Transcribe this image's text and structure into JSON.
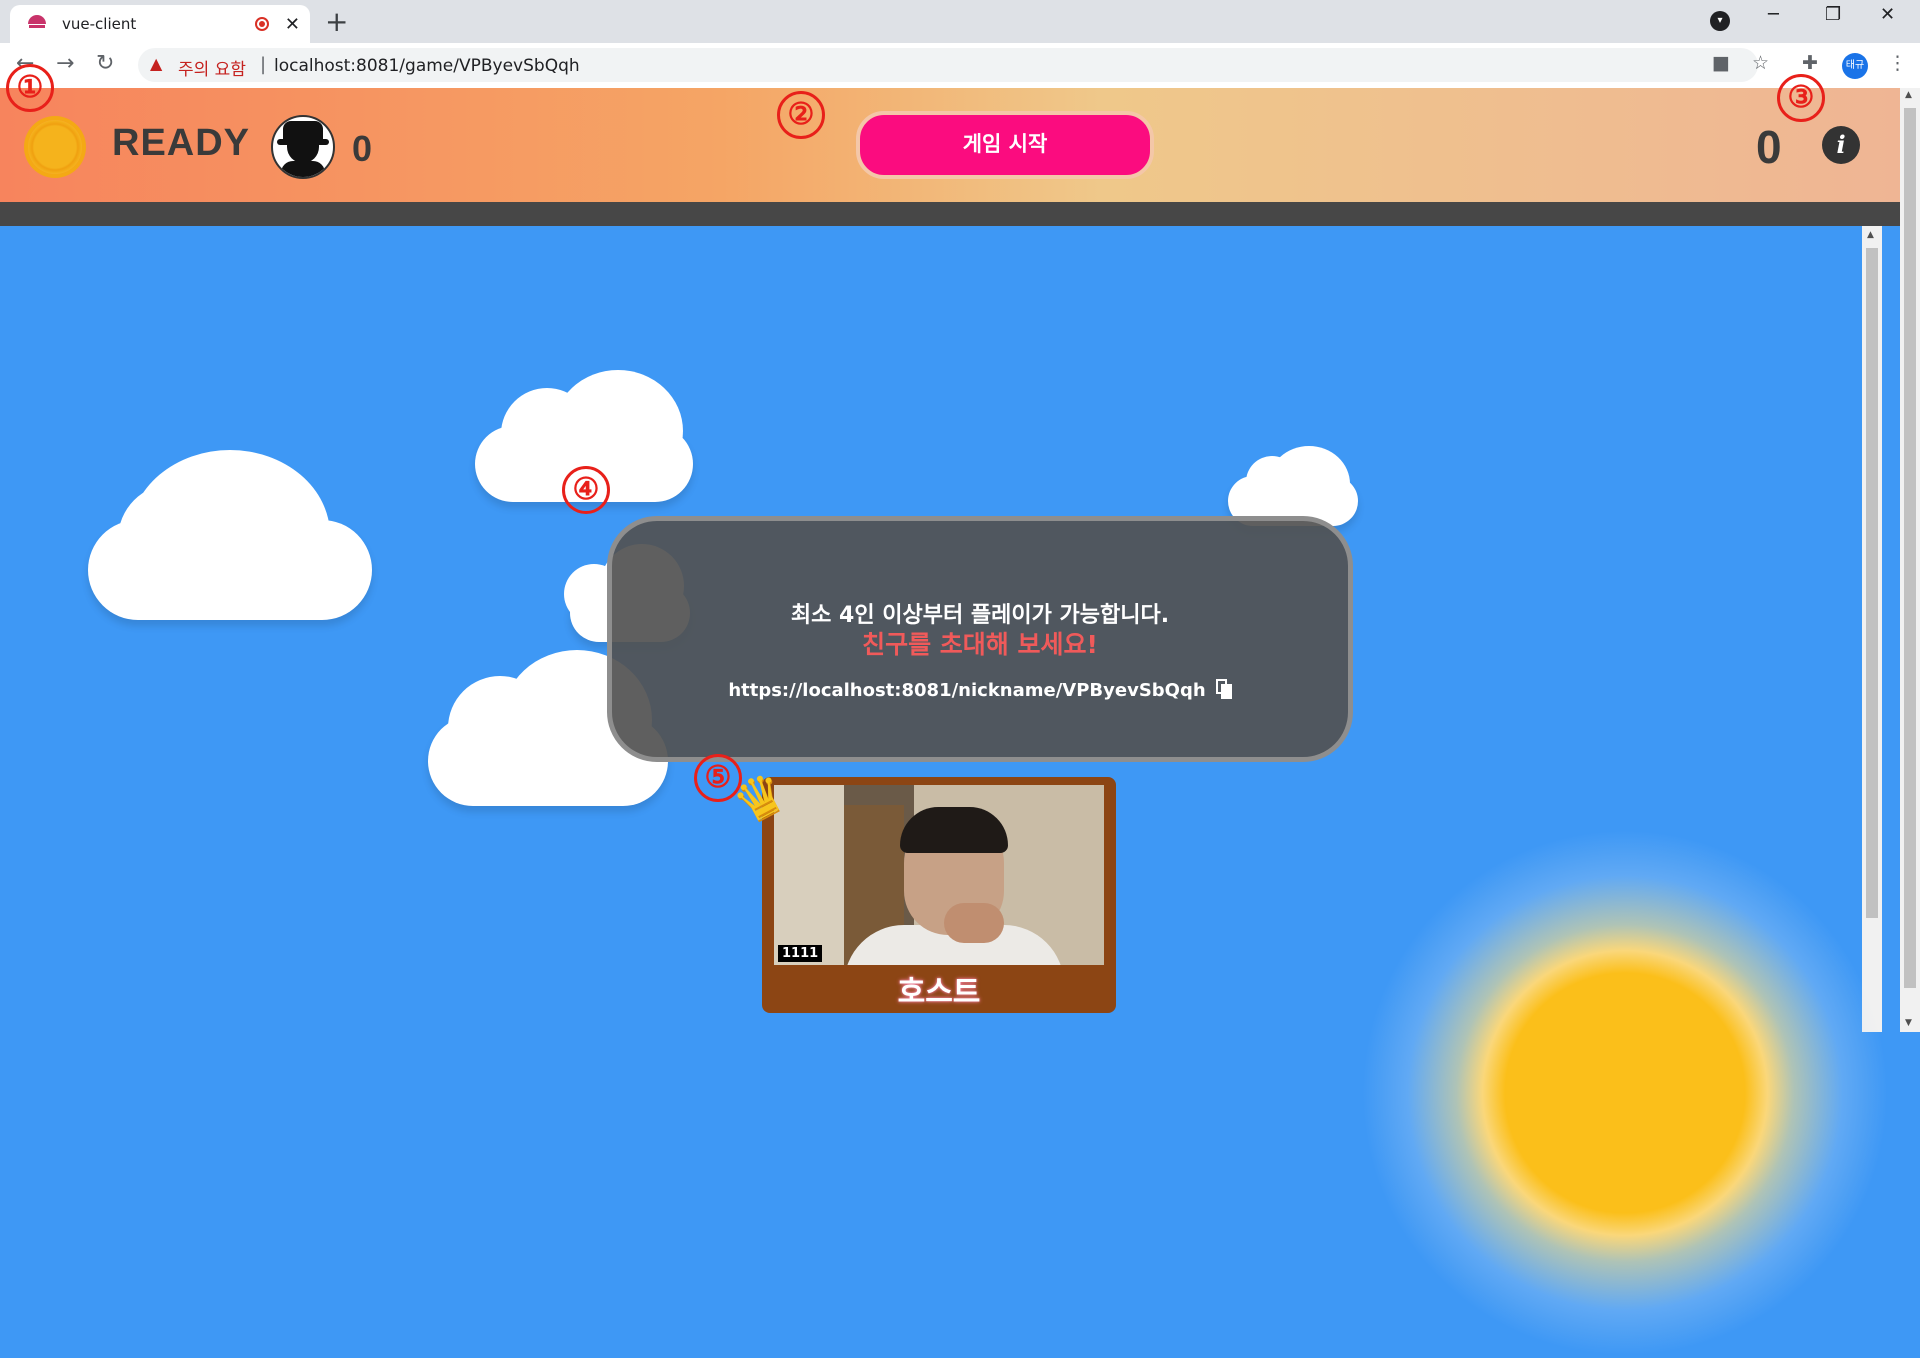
{
  "browser": {
    "tab_title": "vue-client",
    "tab_close": "✕",
    "new_tab": "+",
    "security_warning": "주의 요함",
    "separator": "|",
    "url": "localhost:8081/game/VPByevSbQqh",
    "profile_initials": "태규"
  },
  "header": {
    "phase": "READY",
    "spy_count": "0",
    "start_button_label": "게임 시작",
    "round_count": "0",
    "info_glyph": "i"
  },
  "modal": {
    "line1": "최소 4인 이상부터 플레이가 가능합니다.",
    "line2": "친구를 초대해 보세요!",
    "invite_link": "https://localhost:8081/nickname/VPByevSbQqh"
  },
  "player": {
    "video_id": "1111",
    "name": "호스트"
  },
  "annotations": [
    "①",
    "②",
    "③",
    "④",
    "⑤"
  ],
  "colors": {
    "sky": "#3e98f5",
    "start_button": "#fb0c7f",
    "modal_bg": "#515151",
    "invite_highlight": "#f05a5a",
    "player_card": "#8c4514",
    "annotation": "#e8201a"
  },
  "icons": [
    "sun-icon",
    "spy-icon",
    "info-icon",
    "copy-icon",
    "crown-icon",
    "back-icon",
    "forward-icon",
    "reload-icon",
    "warning-icon",
    "camera-icon",
    "star-icon",
    "extensions-icon",
    "menu-icon"
  ]
}
